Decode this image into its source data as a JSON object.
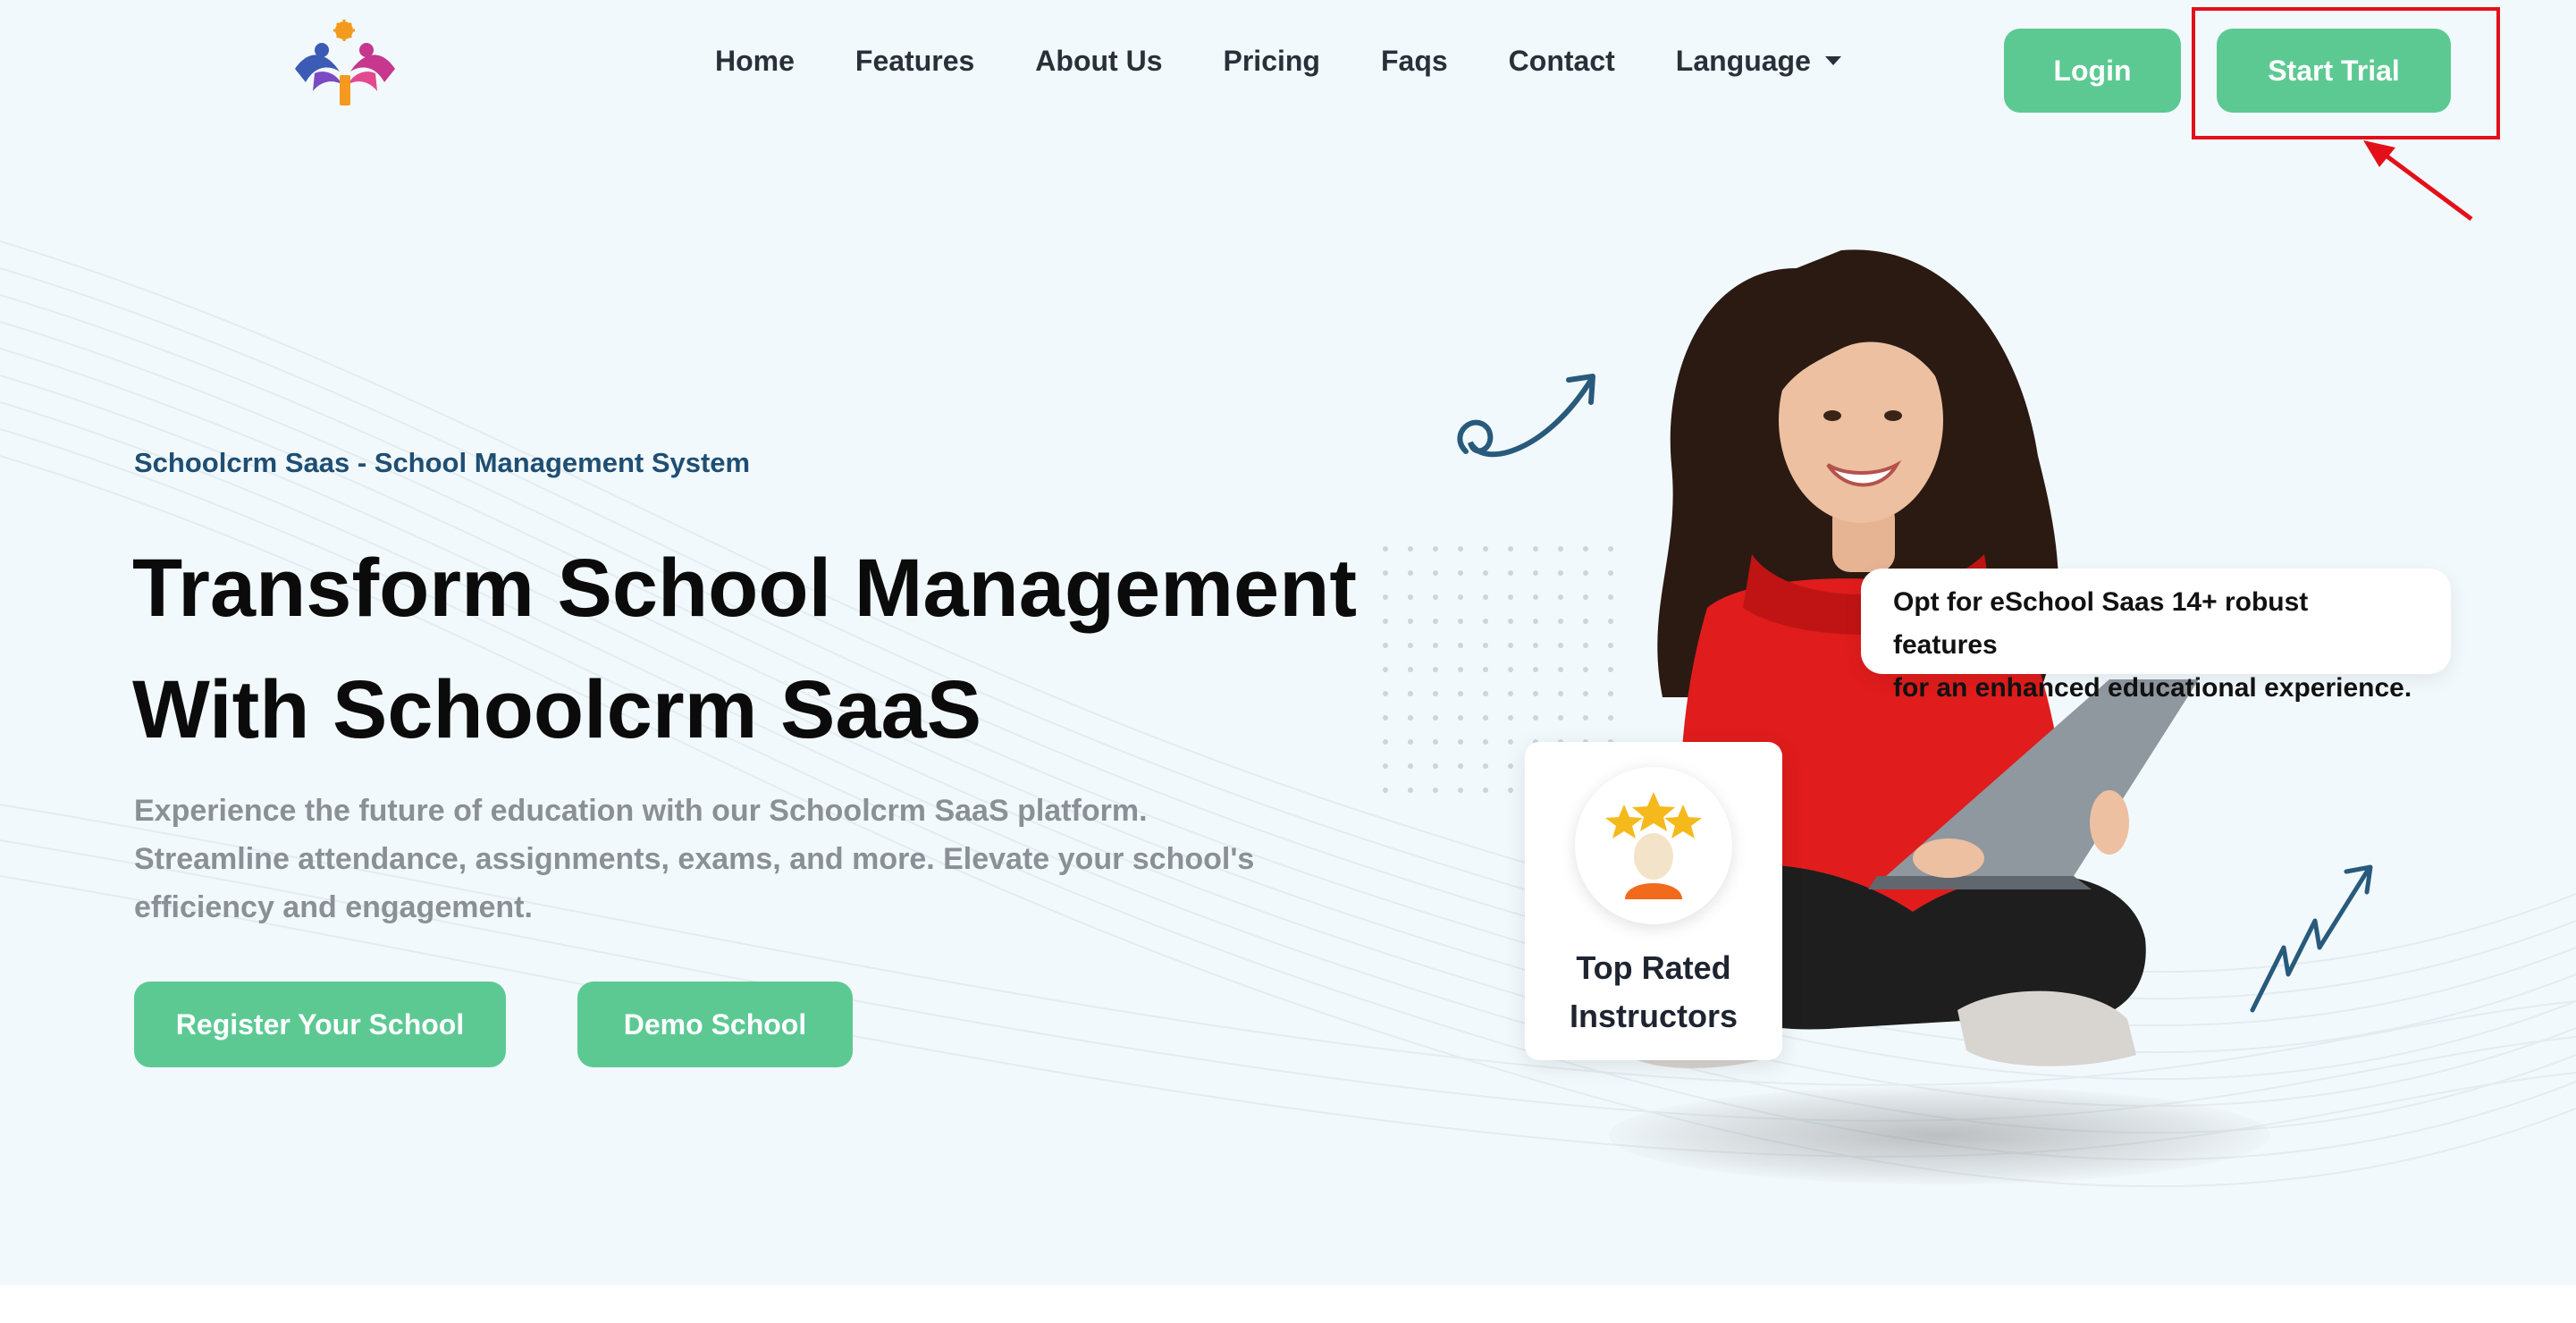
{
  "header": {
    "logo_icon": "school-logo-icon",
    "nav": [
      {
        "label": "Home"
      },
      {
        "label": "Features"
      },
      {
        "label": "About Us"
      },
      {
        "label": "Pricing"
      },
      {
        "label": "Faqs"
      },
      {
        "label": "Contact"
      }
    ],
    "language_label": "Language",
    "login_label": "Login",
    "start_trial_label": "Start Trial"
  },
  "hero": {
    "eyebrow": "Schoolcrm Saas - School Management System",
    "headline_line1": "Transform School Management",
    "headline_line2": "With Schoolcrm SaaS",
    "description": "Experience the future of education with our Schoolcrm SaaS platform. Streamline attendance, assignments, exams, and more. Elevate your school's efficiency and engagement.",
    "register_label": "Register Your School",
    "demo_label": "Demo School"
  },
  "illustration": {
    "callout_line1": "Opt for eSchool Saas 14+ robust features",
    "callout_line2": "for an enhanced educational experience.",
    "card_line1": "Top Rated",
    "card_line2": "Instructors"
  },
  "colors": {
    "background": "#f2f9fc",
    "accent": "#5cc993",
    "eyebrow": "#1f4e73",
    "annotation": "#e3101a"
  }
}
